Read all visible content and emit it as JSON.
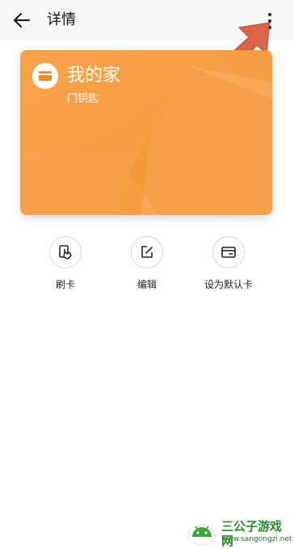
{
  "header": {
    "title": "详情",
    "back_icon": "arrow-left-icon",
    "more_icon": "more-vertical-icon"
  },
  "card": {
    "name": "我的家",
    "type": "门钥匙",
    "icon": "card-icon",
    "colors": {
      "primary": "#f5a04a",
      "accent": "#f08a2a"
    }
  },
  "actions": [
    {
      "label": "刷卡",
      "icon": "swipe-card-icon"
    },
    {
      "label": "编辑",
      "icon": "edit-icon"
    },
    {
      "label": "设为默认卡",
      "icon": "default-card-icon"
    }
  ],
  "watermark": {
    "title": "三公子游戏网",
    "url": "www.sangongzi.net"
  },
  "annotation": {
    "arrow_color": "#d9583b"
  }
}
